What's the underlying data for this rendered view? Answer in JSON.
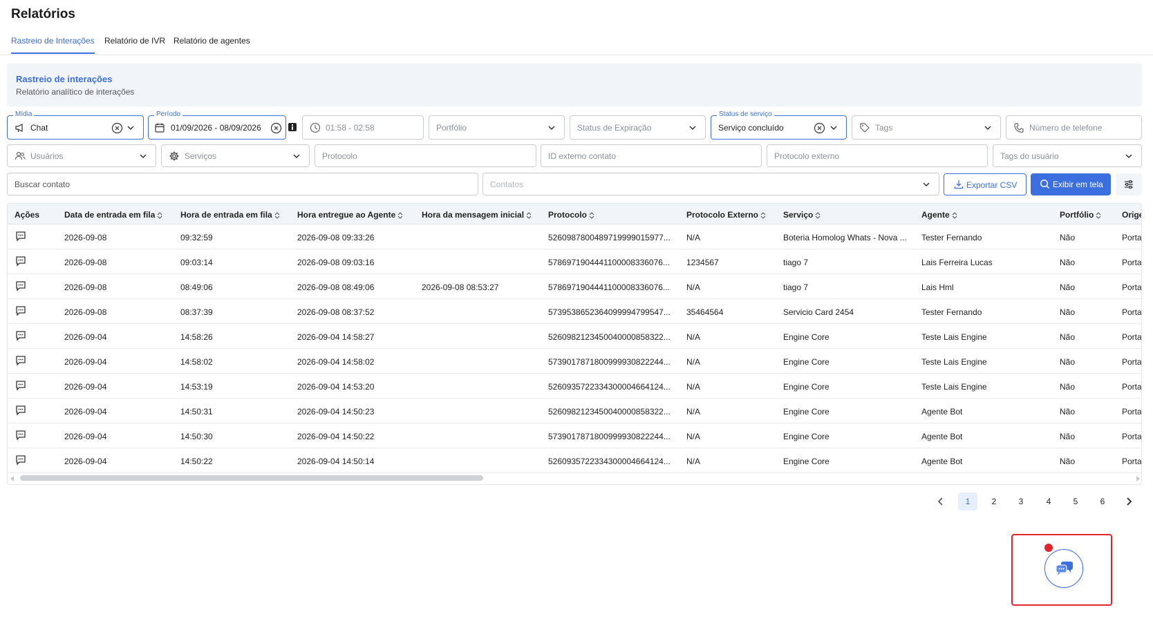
{
  "page": {
    "title": "Relatórios"
  },
  "tabs": [
    {
      "label": "Rastreio de Interações",
      "active": true
    },
    {
      "label": "Relatório de IVR",
      "active": false
    },
    {
      "label": "Relatório de agentes",
      "active": false
    }
  ],
  "banner": {
    "title": "Rastreio de interações",
    "subtitle": "Relatório analítico de interações"
  },
  "filters": {
    "midia": {
      "label": "Mídia",
      "value": "Chat"
    },
    "periodo": {
      "label": "Período",
      "value": "01/09/2026 - 08/09/2026"
    },
    "hora": {
      "placeholder": "01:58 - 02:58"
    },
    "portfolio": {
      "placeholder": "Portfólio"
    },
    "status_expiracao": {
      "placeholder": "Status de Expiração"
    },
    "status_servico": {
      "label": "Status de serviço",
      "value": "Serviço concluído"
    },
    "tags": {
      "placeholder": "Tags"
    },
    "telefone": {
      "placeholder": "Número de telefone"
    },
    "usuarios": {
      "placeholder": "Usuários"
    },
    "servicos": {
      "placeholder": "Serviços"
    },
    "protocolo": {
      "placeholder": "Protocolo"
    },
    "id_externo": {
      "placeholder": "ID externo contato"
    },
    "protocolo_externo": {
      "placeholder": "Protocolo externo"
    },
    "tags_usuario": {
      "placeholder": "Tags do usuário"
    },
    "buscar_contato": {
      "placeholder": "Buscar contato"
    },
    "contatos": {
      "placeholder": "Contatos"
    }
  },
  "actions": {
    "export_label": "Exportar CSV",
    "show_label": "Exibir em tela"
  },
  "table": {
    "headers": [
      "Ações",
      "Data de entrada em fila",
      "Hora de entrada em fila",
      "Hora entregue ao Agente",
      "Hora da mensagem inicial",
      "Protocolo",
      "Protocolo Externo",
      "Serviço",
      "Agente",
      "Portfólio",
      "Orige"
    ],
    "rows": [
      {
        "data": "2026-09-08",
        "hora": "09:32:59",
        "entregue": "2026-09-08 09:33:26",
        "inicial": "",
        "protocolo": "5260987800489719999015977...",
        "externo": "N/A",
        "servico": "Boteria Homolog Whats - Nova ...",
        "agente": "Tester Fernando",
        "portfolio": "Não",
        "origem": "Portal"
      },
      {
        "data": "2026-09-08",
        "hora": "09:03:14",
        "entregue": "2026-09-08 09:03:16",
        "inicial": "",
        "protocolo": "5786971904441100008336076...",
        "externo": "1234567",
        "servico": "tiago 7",
        "agente": "Lais Ferreira Lucas",
        "portfolio": "Não",
        "origem": "Portal"
      },
      {
        "data": "2026-09-08",
        "hora": "08:49:06",
        "entregue": "2026-09-08 08:49:06",
        "inicial": "2026-09-08 08:53:27",
        "protocolo": "5786971904441100008336076...",
        "externo": "N/A",
        "servico": "tiago 7",
        "agente": "Lais Hml",
        "portfolio": "Não",
        "origem": "Portal"
      },
      {
        "data": "2026-09-08",
        "hora": "08:37:39",
        "entregue": "2026-09-08 08:37:52",
        "inicial": "",
        "protocolo": "5739538652364099994799547...",
        "externo": "35464564",
        "servico": "Servicio Card 2454",
        "agente": "Tester Fernando",
        "portfolio": "Não",
        "origem": "Portal"
      },
      {
        "data": "2026-09-04",
        "hora": "14:58:26",
        "entregue": "2026-09-04 14:58:27",
        "inicial": "",
        "protocolo": "5260982123450040000858322...",
        "externo": "N/A",
        "servico": "Engine Core",
        "agente": "Teste Lais Engine",
        "portfolio": "Não",
        "origem": "Portal"
      },
      {
        "data": "2026-09-04",
        "hora": "14:58:02",
        "entregue": "2026-09-04 14:58:02",
        "inicial": "",
        "protocolo": "5739017871800999930822244...",
        "externo": "N/A",
        "servico": "Engine Core",
        "agente": "Teste Lais Engine",
        "portfolio": "Não",
        "origem": "Portal"
      },
      {
        "data": "2026-09-04",
        "hora": "14:53:19",
        "entregue": "2026-09-04 14:53:20",
        "inicial": "",
        "protocolo": "5260935722334300004664124...",
        "externo": "N/A",
        "servico": "Engine Core",
        "agente": "Teste Lais Engine",
        "portfolio": "Não",
        "origem": "Portal"
      },
      {
        "data": "2026-09-04",
        "hora": "14:50:31",
        "entregue": "2026-09-04 14:50:23",
        "inicial": "",
        "protocolo": "5260982123450040000858322...",
        "externo": "N/A",
        "servico": "Engine Core",
        "agente": "Agente Bot",
        "portfolio": "Não",
        "origem": "Portal"
      },
      {
        "data": "2026-09-04",
        "hora": "14:50:30",
        "entregue": "2026-09-04 14:50:22",
        "inicial": "",
        "protocolo": "5739017871800999930822244...",
        "externo": "N/A",
        "servico": "Engine Core",
        "agente": "Agente Bot",
        "portfolio": "Não",
        "origem": "Portal"
      },
      {
        "data": "2026-09-04",
        "hora": "14:50:22",
        "entregue": "2026-09-04 14:50:14",
        "inicial": "",
        "protocolo": "5260935722334300004664124...",
        "externo": "N/A",
        "servico": "Engine Core",
        "agente": "Agente Bot",
        "portfolio": "Não",
        "origem": "Portal"
      }
    ]
  },
  "pagination": {
    "pages": [
      "1",
      "2",
      "3",
      "4",
      "5",
      "6"
    ],
    "current": "1"
  },
  "icons": {
    "chat_row": "chat-bubble-icon",
    "calendar": "calendar-icon",
    "clock": "clock-icon",
    "tag": "tag-icon",
    "phone": "phone-icon",
    "users": "users-icon",
    "settings": "gear-icon",
    "download": "download-icon",
    "search": "search-icon",
    "sliders": "sliders-icon",
    "chat_widget": "chat-widget-icon"
  },
  "colors": {
    "accent": "#3b6fe0",
    "alert": "#e0262b",
    "banner_bg": "#f1f4f8"
  }
}
